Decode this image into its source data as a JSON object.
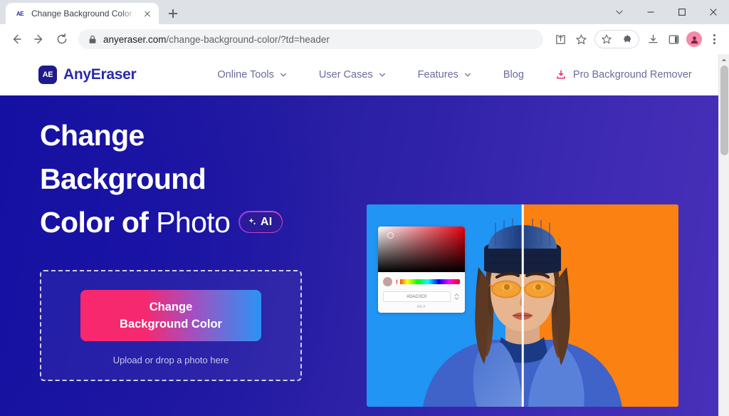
{
  "browser": {
    "tab": {
      "favicon": "ae-favicon",
      "title": "Change Background Color On",
      "close_icon": "close-icon"
    },
    "new_tab_icon": "plus-icon",
    "window_controls": {
      "tab_search_icon": "chevron-down-icon",
      "minimize_icon": "minimize-icon",
      "maximize_icon": "maximize-icon",
      "close_icon": "close-icon"
    },
    "nav": {
      "back_icon": "arrow-left-icon",
      "forward_icon": "arrow-right-icon",
      "reload_icon": "reload-icon"
    },
    "omnibox": {
      "lock_icon": "lock-icon",
      "domain": "anyeraser.com",
      "path": "/change-background-color/?td=header"
    },
    "toolbar_icons": {
      "share": "share-icon",
      "bookmark": "bookmark-star-icon",
      "extension_star": "star-icon",
      "extensions": "puzzle-piece-icon",
      "downloads": "download-icon",
      "side_panel": "side-panel-icon",
      "profile": "profile-avatar",
      "menu": "kebab-menu-icon"
    },
    "scrollbar": {
      "up_arrow_icon": "caret-up-icon",
      "thumb": "scrollbar-thumb"
    }
  },
  "site": {
    "logo": {
      "mark_text": "AE",
      "name": "AnyEraser"
    },
    "nav_items": [
      {
        "label": "Online Tools",
        "has_caret": true,
        "icon": null
      },
      {
        "label": "User Cases",
        "has_caret": true,
        "icon": null
      },
      {
        "label": "Features",
        "has_caret": true,
        "icon": null
      },
      {
        "label": "Blog",
        "has_caret": false,
        "icon": null
      },
      {
        "label": "Pro Background Remover",
        "has_caret": false,
        "icon": "download-icon"
      }
    ]
  },
  "hero": {
    "heading_bold_1": "Change",
    "heading_bold_2": "Background",
    "heading_bold_3": "Color of",
    "heading_light": "Photo",
    "ai_badge": {
      "sparkle_icon": "sparkle-icon",
      "label": "AI"
    },
    "dropzone": {
      "cta_line1": "Change",
      "cta_line2": "Background Color",
      "hint": "Upload or drop a photo here"
    },
    "image": {
      "alt_name": "before-after-photo",
      "left_background_color": "#2095f3",
      "right_background_color": "#fa8112",
      "picker": {
        "hex_value": "#DAC0C0",
        "hex_label": "HEX",
        "swatch_color": "#c2a3a3",
        "eyedropper_icon": "picker-knob-icon",
        "stepper_icon": "stepper-icon"
      }
    },
    "colors": {
      "gradient_start": "#1410a0",
      "gradient_end": "#4930b8",
      "cta_gradient_start": "#f8276e",
      "cta_gradient_end": "#2b93f5",
      "accent_pink": "#ef3b78",
      "brand_indigo": "#2b2aa8"
    }
  }
}
